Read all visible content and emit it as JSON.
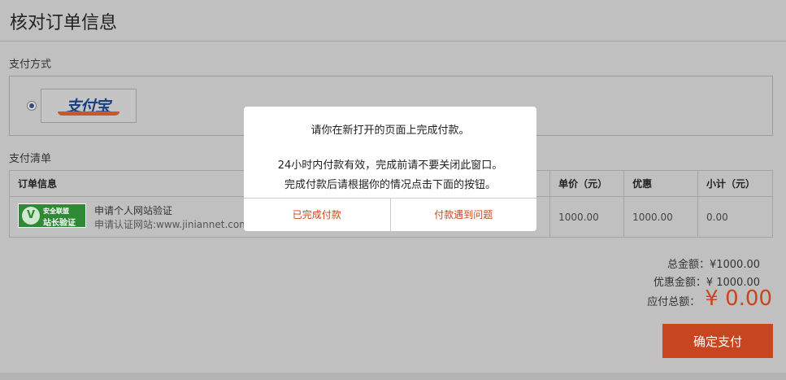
{
  "page": {
    "title": "核对订单信息"
  },
  "payment": {
    "section_label": "支付方式",
    "method_logo_text": "支付宝",
    "selected": true
  },
  "order_list": {
    "section_label": "支付清单",
    "headers": [
      "订单信息",
      "单价（元）",
      "优惠",
      "小计（元）"
    ],
    "item": {
      "badge_line1": "安全联盟",
      "badge_line2": "站长验证",
      "badge_icon": "V",
      "name": "申请个人网站验证",
      "sub": "申请认证网站:www.jiniannet.com",
      "price": "1000.00",
      "discount": "1000.00",
      "subtotal": "0.00"
    }
  },
  "summary": {
    "total_label": "总金额：",
    "total_value": "¥1000.00",
    "discount_label": "优惠金额：",
    "discount_value": "¥ 1000.00",
    "payable_label": "应付总额：",
    "payable_value": "¥ 0.00"
  },
  "confirm_button": "确定支付",
  "modal": {
    "line1": "请你在新打开的页面上完成付款。",
    "line2": "24小时内付款有效，完成前请不要关闭此窗口。",
    "line3": "完成付款后请根据你的情况点击下面的按钮。",
    "done_button": "已完成付款",
    "problem_button": "付款遇到问题"
  },
  "colors": {
    "accent": "#c8461f",
    "overlay": "#c0c0c0",
    "brand_blue": "#1b3f7f",
    "badge_green": "#2e8a35"
  }
}
